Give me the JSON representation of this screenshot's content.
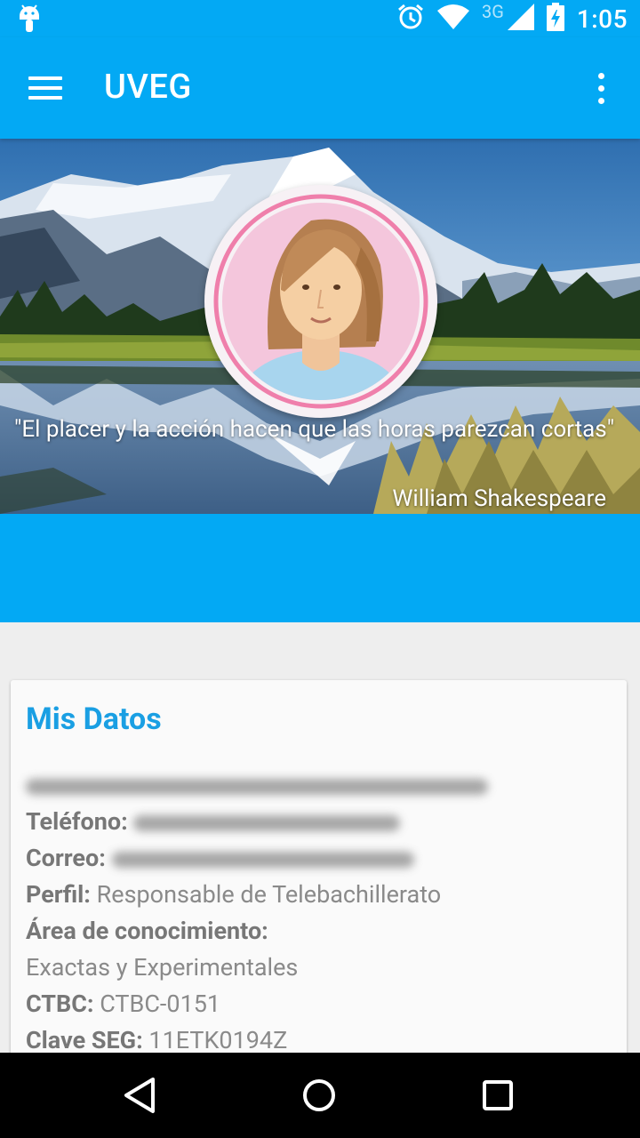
{
  "status_bar": {
    "time": "1:05",
    "network": "3G",
    "icons": [
      "android-icon",
      "alarm-icon",
      "wifi-icon",
      "signal-icon",
      "battery-icon"
    ]
  },
  "app_bar": {
    "title": "UVEG",
    "menu_icon": "hamburger-menu-icon",
    "overflow_icon": "more-vertical-icon"
  },
  "header": {
    "quote": "\"El placer y la acción hacen que las horas parezcan cortas\"",
    "author": "William Shakespeare"
  },
  "card": {
    "title": "Mis Datos",
    "fields": {
      "telefono_label": "Teléfono:",
      "correo_label": "Correo:",
      "perfil_label": "Perfil:",
      "perfil_value": "Responsable de Telebachillerato",
      "area_label": "Área de conocimiento:",
      "area_value": "Exactas y Experimentales",
      "ctbc_label": "CTBC:",
      "ctbc_value": "CTBC-0151",
      "clave_label": "Clave SEG:",
      "clave_value": "11ETK0194Z"
    }
  },
  "nav_bar": {
    "back_icon": "back-triangle-icon",
    "home_icon": "home-circle-icon",
    "recents_icon": "recents-square-icon"
  },
  "colors": {
    "primary": "#03a9f4",
    "title_accent": "#1a9fe3",
    "background": "#eeeeee"
  }
}
